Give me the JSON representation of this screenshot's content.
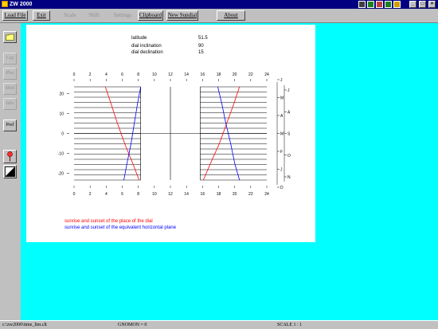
{
  "window": {
    "title": "ZW 2000"
  },
  "toolbar": {
    "load_file": "Load File",
    "exit": "Exit",
    "scale": "Scale",
    "shift": "Shift",
    "settings": "Settings",
    "clipboard": "Clipboard",
    "new_sundial": "New Sundial",
    "about": "About"
  },
  "sidepanel": {
    "buttons": [
      "Cap",
      "Plot",
      "Mod",
      "Info",
      "Pref"
    ]
  },
  "dial": {
    "latitude_label": "latitude",
    "latitude_value": "51.5",
    "inclination_label": "dial inclination",
    "inclination_value": "90",
    "declination_label": "dial declination",
    "declination_value": "15"
  },
  "legend": {
    "red": "sunrise and sunset of the place of the dial",
    "blue": "sunrise and sunset of the equivalent horizontal plane",
    "red_color": "#ff0000",
    "blue_color": "#0000ff"
  },
  "chart_data": {
    "type": "line",
    "x_ticks": [
      "0",
      "2",
      "4",
      "6",
      "8",
      "10",
      "12",
      "14",
      "16",
      "18",
      "20",
      "22",
      "24"
    ],
    "y_ticks": [
      "20",
      "10",
      "0",
      "-10",
      "-20"
    ],
    "months_right": [
      "J",
      "M",
      "A",
      "M",
      "F",
      "J",
      "D"
    ],
    "months_right2": [
      "J",
      "A",
      "S",
      "O",
      "N"
    ],
    "xlim": [
      0,
      24
    ],
    "ylim": [
      -23.44,
      23.44
    ],
    "series": [
      {
        "color": "#ff0000",
        "points": [
          [
            3.9,
            23.44
          ],
          [
            4.6,
            15
          ],
          [
            5.4,
            5
          ],
          [
            6.3,
            -5
          ],
          [
            7.3,
            -15
          ],
          [
            8.1,
            -23.44
          ]
        ]
      },
      {
        "color": "#ff0000",
        "points": [
          [
            20.6,
            23.44
          ],
          [
            19.9,
            15
          ],
          [
            19.0,
            5
          ],
          [
            18.1,
            -5
          ],
          [
            17.0,
            -15
          ],
          [
            16.1,
            -23.44
          ]
        ]
      },
      {
        "color": "#0000ff",
        "points": [
          [
            8.3,
            23.44
          ],
          [
            7.9,
            15
          ],
          [
            7.5,
            5
          ],
          [
            7.1,
            -5
          ],
          [
            6.6,
            -15
          ],
          [
            6.2,
            -23.44
          ]
        ]
      },
      {
        "color": "#0000ff",
        "points": [
          [
            17.9,
            23.44
          ],
          [
            18.4,
            15
          ],
          [
            18.9,
            5
          ],
          [
            19.5,
            -5
          ],
          [
            20.0,
            -15
          ],
          [
            20.6,
            -23.44
          ]
        ]
      }
    ]
  },
  "status": {
    "file": "c:\\zw2000\\time_lim.clt",
    "gnomon": "GNOMON = 0",
    "scale": "SCALE 1 : 1"
  }
}
